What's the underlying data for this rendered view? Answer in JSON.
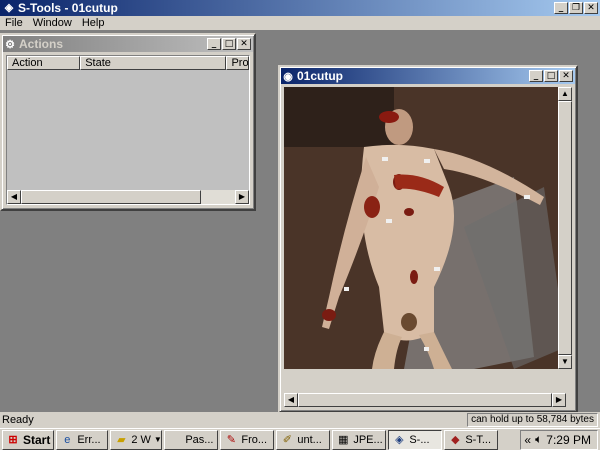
{
  "app": {
    "title": "S-Tools - 01cutup",
    "caption_buttons": [
      "_",
      "❐",
      "✕"
    ]
  },
  "menu": [
    "File",
    "Window",
    "Help"
  ],
  "actions_window": {
    "title": "Actions",
    "columns": [
      "Action",
      "State",
      "Pro"
    ],
    "caption_buttons": [
      "_",
      "□",
      "✕"
    ]
  },
  "image_window": {
    "title": "01cutup",
    "caption_buttons": [
      "_",
      "□",
      "✕"
    ]
  },
  "status": {
    "left": "Ready",
    "right": "can hold up to 58,784 bytes"
  },
  "taskbar": {
    "start_label": "Start",
    "buttons": [
      "Err...",
      "2 W",
      "Pas...",
      "Fro...",
      "unt...",
      "JPE...",
      "S-...",
      "S-T..."
    ],
    "tray_chevron": "«",
    "clock": "7:29 PM"
  },
  "colors": {
    "title_active": "#0a246a",
    "title_inactive": "#808080",
    "face": "#d4d0c8",
    "desktop": "#808080"
  },
  "icons": {
    "app": "s-tools-icon",
    "start": "windows-logo-icon",
    "tray": "volume-icon"
  }
}
